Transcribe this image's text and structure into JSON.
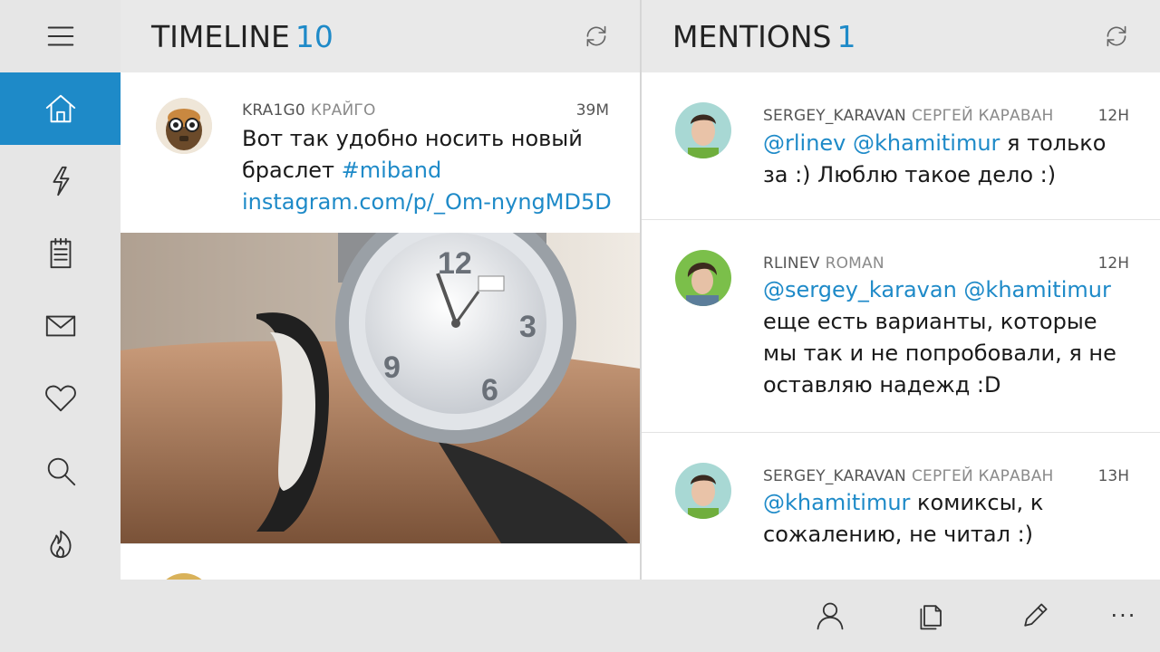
{
  "colors": {
    "accent": "#1e8ac8",
    "rail_bg": "#e6e6e6",
    "header_bg": "#e9e9e9"
  },
  "rail": {
    "items": [
      {
        "icon": "menu-icon"
      },
      {
        "icon": "home-icon",
        "active": true
      },
      {
        "icon": "lightning-icon"
      },
      {
        "icon": "list-icon"
      },
      {
        "icon": "mail-icon"
      },
      {
        "icon": "heart-icon"
      },
      {
        "icon": "search-icon"
      },
      {
        "icon": "fire-icon"
      }
    ]
  },
  "timeline": {
    "title": "TIMELINE",
    "count": "10",
    "refresh_icon": "refresh-icon",
    "tweets": [
      {
        "username": "KRA1G0",
        "display_name": "КРАЙГО",
        "time": "39M",
        "text_plain": "Вот так удобно носить новый браслет ",
        "hashtag": "#miband",
        "url": "instagram.com/p/_Om-nyngMD5D..."
      }
    ]
  },
  "mentions": {
    "title": "MENTIONS",
    "count": "1",
    "refresh_icon": "refresh-icon",
    "tweets": [
      {
        "username": "SERGEY_KARAVAN",
        "display_name": "СЕРГЕЙ КАРАВАН",
        "time": "12H",
        "mention": "@rlinev @khamitimur",
        "text": " я только за :) Люблю такое дело :)"
      },
      {
        "username": "RLINEV",
        "display_name": "ROMAN",
        "time": "12H",
        "mention": "@sergey_karavan @khamitimur",
        "text": "еще есть варианты, которые мы так и не попробовали, я не оставляю надежд :D"
      },
      {
        "username": "SERGEY_KARAVAN",
        "display_name": "СЕРГЕЙ КАРАВАН",
        "time": "13H",
        "mention": "@khamitimur",
        "text": " комиксы, к сожалению, не читал :)"
      }
    ]
  },
  "appbar": {
    "buttons": [
      "person-icon",
      "copy-icon",
      "compose-icon"
    ],
    "more_label": "···"
  }
}
